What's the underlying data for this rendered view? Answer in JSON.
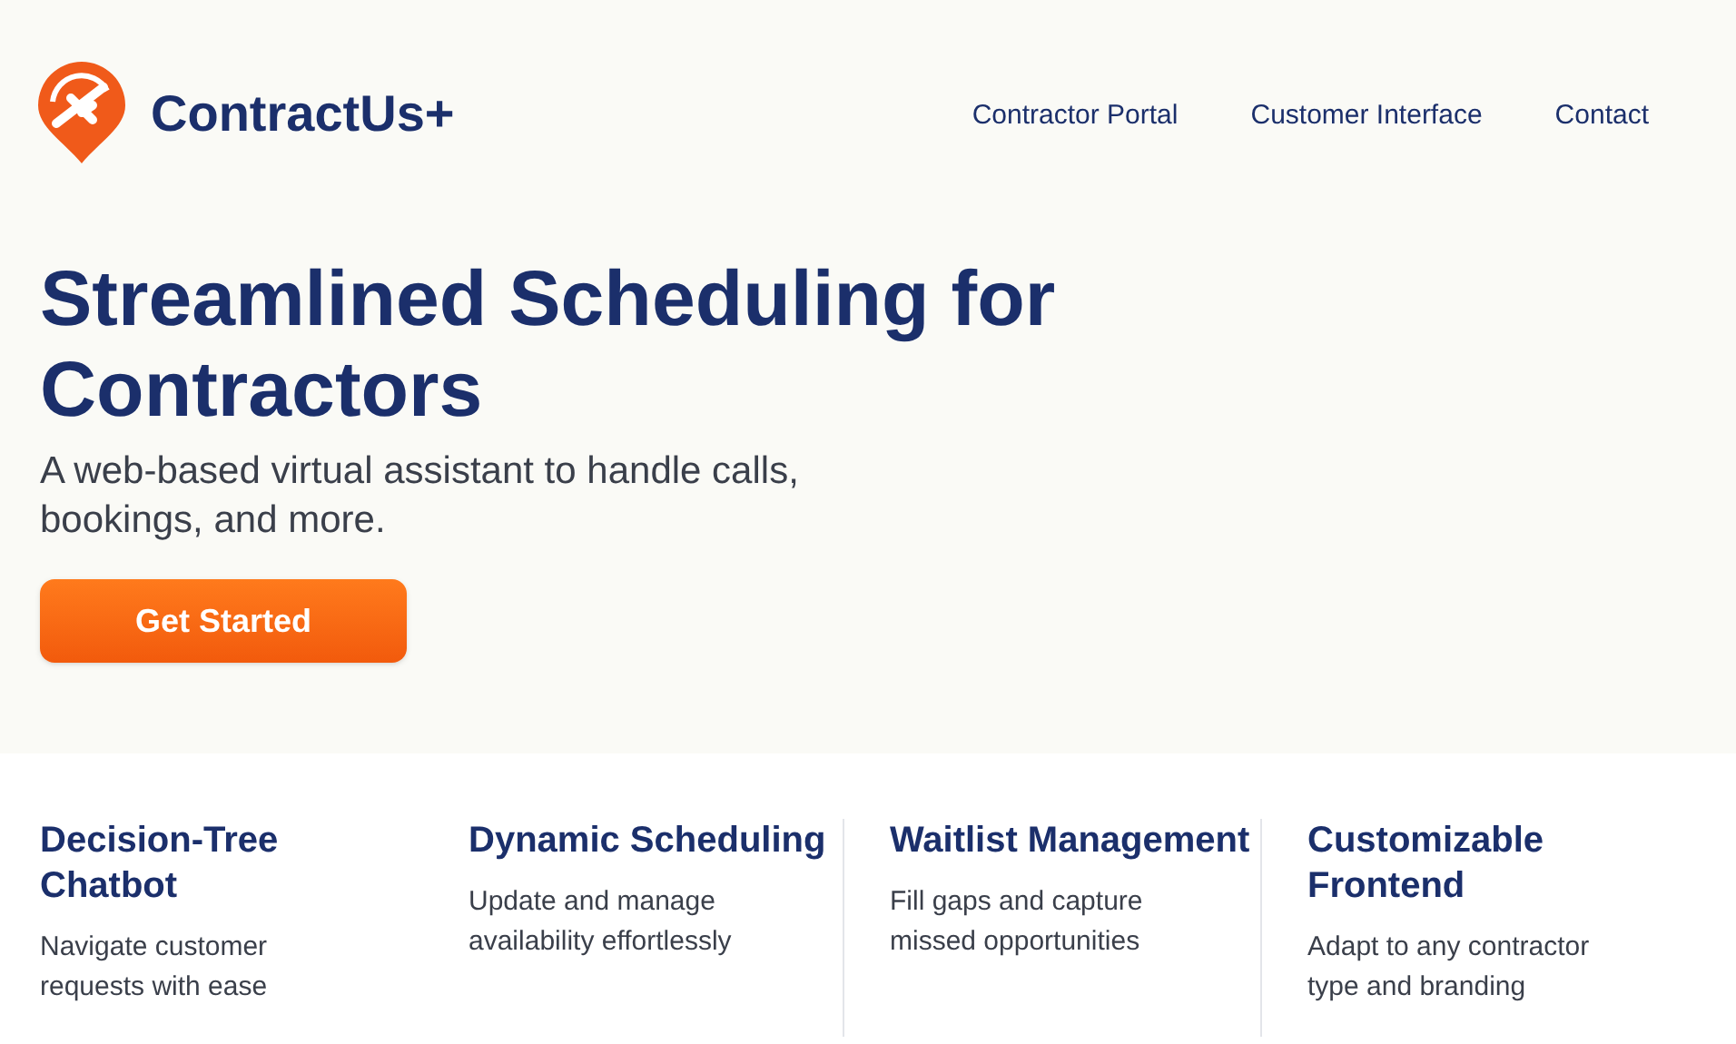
{
  "brand": {
    "name": "ContractUs+"
  },
  "nav": [
    {
      "label": "Contractor Portal"
    },
    {
      "label": "Customer Interface"
    },
    {
      "label": "Contact"
    }
  ],
  "hero": {
    "title": "Streamlined Scheduling for Contractors",
    "subtitle": "A web-based virtual assistant to handle calls, bookings, and more.",
    "button": "Get Started"
  },
  "features": [
    {
      "title": "Decision-Tree Chatbot",
      "description": "Navigate customer requests with ease"
    },
    {
      "title": "Dynamic Scheduling",
      "description": "Update and manage availability effortlessly"
    },
    {
      "title": "Waitlist Management",
      "description": "Fill gaps and capture missed opportunities"
    },
    {
      "title": "Customizable Frontend",
      "description": "Adapt to any contractor type and branding"
    }
  ]
}
